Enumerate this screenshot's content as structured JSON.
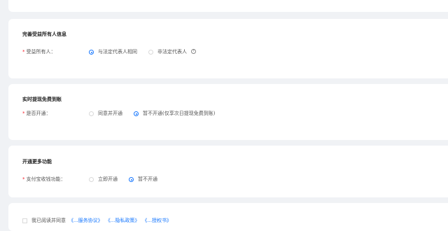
{
  "sections": [
    {
      "title": "完善受益所有人信息",
      "field_label": "受益所有人：",
      "options": [
        {
          "label": "与法定代表人相同",
          "selected": true
        },
        {
          "label": "非法定代表人",
          "selected": false
        }
      ],
      "help_icon": "question-circle-icon"
    },
    {
      "title": "实时提现免费到账",
      "field_label": "是否开通：",
      "options": [
        {
          "label": "同意并开通",
          "selected": false
        },
        {
          "label": "暂不开通(仅享次日提现免费到账)",
          "selected": true
        }
      ]
    },
    {
      "title": "开通更多功能",
      "field_label": "支付宝收钱功能：",
      "options": [
        {
          "label": "立即开通",
          "selected": false
        },
        {
          "label": "暂不开通",
          "selected": true
        }
      ]
    }
  ],
  "agreement": {
    "prefix": "我已阅读并同意",
    "links": [
      "《...服务协议》",
      "《...隐私政策》",
      "《...授权书》"
    ]
  },
  "colors": {
    "accent": "#1677ff",
    "required": "#f5222d",
    "background": "#f0f2f5"
  }
}
